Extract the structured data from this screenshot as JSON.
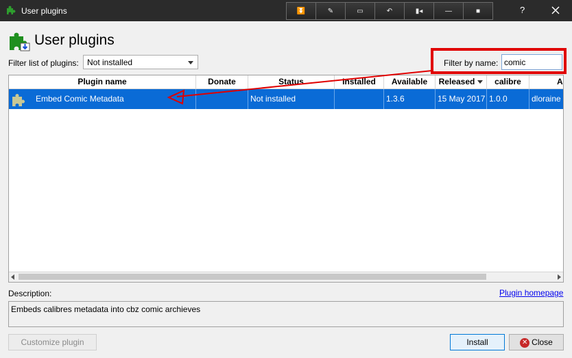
{
  "window": {
    "title": "User plugins",
    "toolbar": [
      {
        "name": "restore-down",
        "glyph": "⏬"
      },
      {
        "name": "pin",
        "glyph": "✎"
      },
      {
        "name": "screen",
        "glyph": "▭"
      },
      {
        "name": "undo",
        "glyph": "↶"
      },
      {
        "name": "record",
        "glyph": "▮◂"
      },
      {
        "name": "minimize",
        "glyph": "—"
      },
      {
        "name": "stop",
        "glyph": "■"
      }
    ],
    "help": "?"
  },
  "header": {
    "title": "User plugins"
  },
  "filter": {
    "label": "Filter list of plugins:",
    "selected": "Not installed",
    "name_label": "Filter by name:",
    "name_value": "comic"
  },
  "table": {
    "columns": [
      "Plugin name",
      "Donate",
      "Status",
      "Installed",
      "Available",
      "Released",
      "calibre",
      "Aut"
    ],
    "rows": [
      {
        "plugin_name": "Embed Comic Metadata",
        "donate": "",
        "status": "Not installed",
        "installed": "",
        "available": "1.3.6",
        "released": "15 May 2017",
        "calibre": "1.0.0",
        "author": "dloraine"
      }
    ],
    "selected_row_color": "#0a6bd6"
  },
  "description": {
    "label": "Description:",
    "homepage_link": "Plugin homepage",
    "text": "Embeds calibres metadata into cbz comic archieves"
  },
  "buttons": {
    "customize": "Customize plugin",
    "install": "Install",
    "close": "Close"
  },
  "annotation_color": "#e00000"
}
